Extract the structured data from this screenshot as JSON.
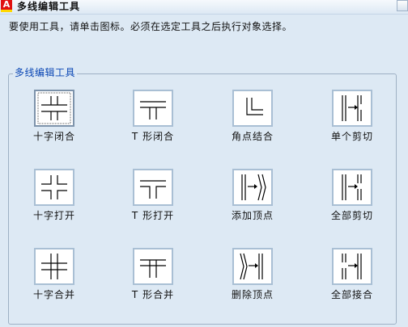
{
  "window": {
    "title": "多线编辑工具",
    "app_icon_letter": "A"
  },
  "instructions": "要使用工具，请单击图标。必须在选定工具之后执行对象选择。",
  "group": {
    "title": "多线编辑工具"
  },
  "tools": [
    {
      "label": "十字闭合",
      "icon": "closed-cross-icon",
      "selected": true
    },
    {
      "label": "T 形闭合",
      "icon": "closed-tee-icon",
      "selected": false
    },
    {
      "label": "角点结合",
      "icon": "corner-joint-icon",
      "selected": false
    },
    {
      "label": "单个剪切",
      "icon": "cut-single-icon",
      "selected": false
    },
    {
      "label": "十字打开",
      "icon": "open-cross-icon",
      "selected": false
    },
    {
      "label": "T 形打开",
      "icon": "open-tee-icon",
      "selected": false
    },
    {
      "label": "添加顶点",
      "icon": "add-vertex-icon",
      "selected": false
    },
    {
      "label": "全部剪切",
      "icon": "cut-all-icon",
      "selected": false
    },
    {
      "label": "十字合并",
      "icon": "merged-cross-icon",
      "selected": false
    },
    {
      "label": "T 形合并",
      "icon": "merged-tee-icon",
      "selected": false
    },
    {
      "label": "删除顶点",
      "icon": "delete-vertex-icon",
      "selected": false
    },
    {
      "label": "全部接合",
      "icon": "weld-all-icon",
      "selected": false
    }
  ]
}
